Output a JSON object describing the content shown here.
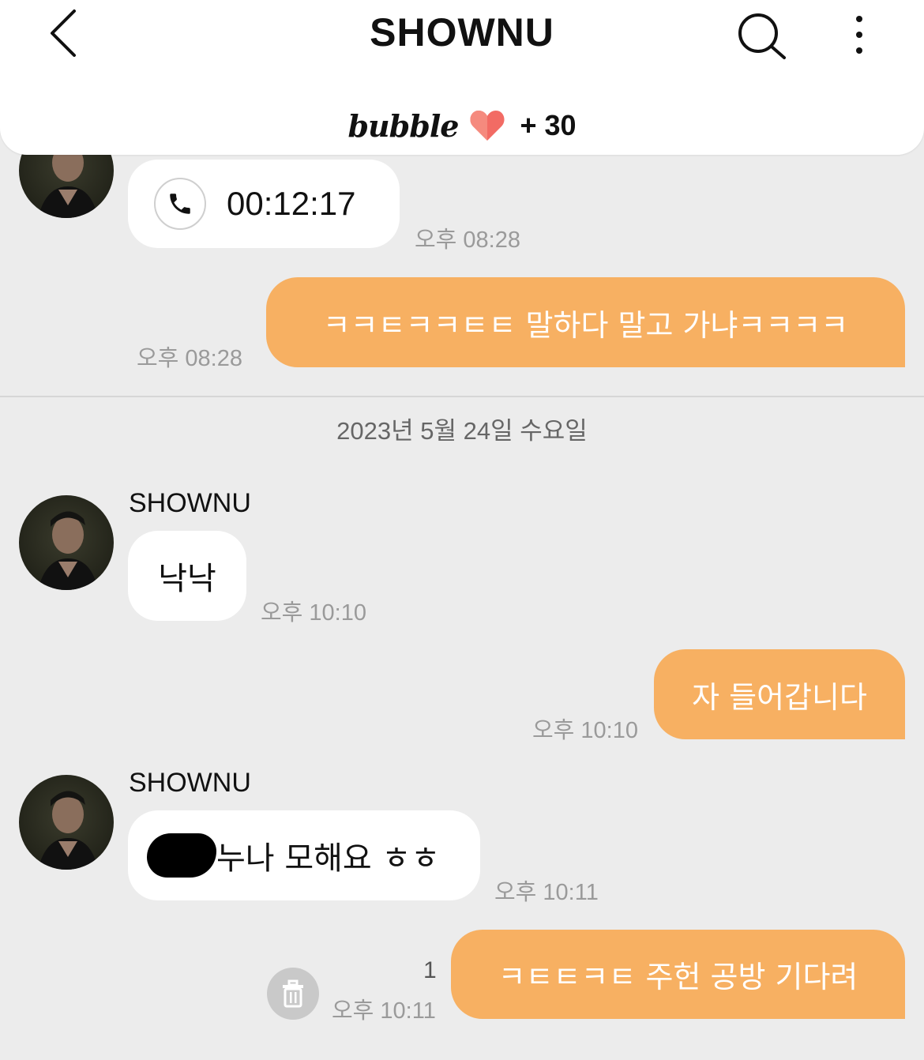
{
  "header": {
    "title": "SHOWNU",
    "bubble_logo": "bubble",
    "bubble_count": "+ 30"
  },
  "messages": {
    "call": {
      "duration": "00:12:17",
      "time": "오후 08:28"
    },
    "out1": {
      "text": "ㅋㅋㅌㅋㅋㅌㅌ 말하다 말고 가냐ㅋㅋㅋㅋ",
      "time": "오후 08:28"
    },
    "date_separator": "2023년 5월 24일 수요일",
    "in1": {
      "sender": "SHOWNU",
      "text": "낙낙",
      "time": "오후 10:10"
    },
    "out2": {
      "text": "자 들어갑니다",
      "time": "오후 10:10"
    },
    "in2": {
      "sender": "SHOWNU",
      "text": "누나 모해요 ㅎㅎ",
      "time": "오후 10:11"
    },
    "out3": {
      "text": "ㅋㅌㅌㅋㅌ 주헌 공방 기다려",
      "time": "오후 10:11",
      "unread": "1"
    }
  },
  "colors": {
    "background": "#ececec",
    "outgoing_bubble": "#f7b062",
    "incoming_bubble": "#ffffff",
    "heart": "#f26b64"
  },
  "icons": [
    "back-arrow-icon",
    "search-icon",
    "more-vertical-icon",
    "heart-icon",
    "phone-icon",
    "trash-icon"
  ]
}
